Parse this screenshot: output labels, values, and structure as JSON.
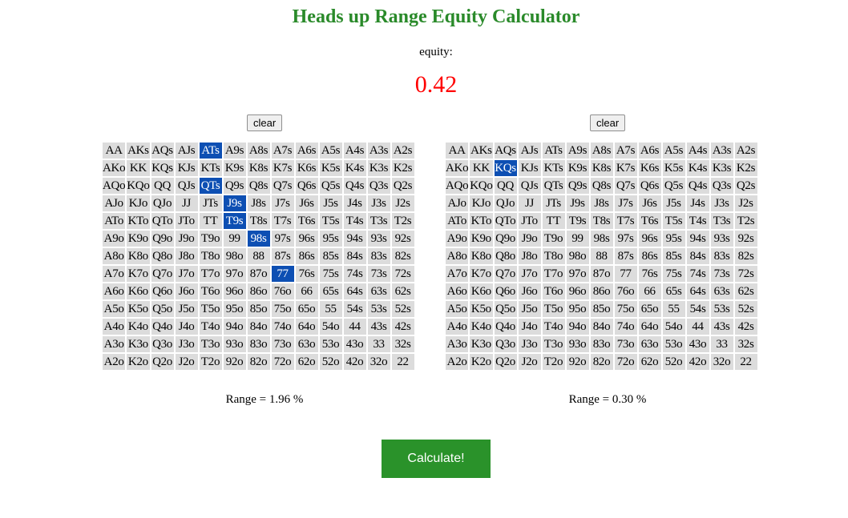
{
  "title": "Heads up Range Equity Calculator",
  "equity": {
    "label": "equity:",
    "value": "0.42"
  },
  "clear_label": "clear",
  "calculate_label": "Calculate!",
  "hands": [
    [
      "AA",
      "AKs",
      "AQs",
      "AJs",
      "ATs",
      "A9s",
      "A8s",
      "A7s",
      "A6s",
      "A5s",
      "A4s",
      "A3s",
      "A2s"
    ],
    [
      "AKo",
      "KK",
      "KQs",
      "KJs",
      "KTs",
      "K9s",
      "K8s",
      "K7s",
      "K6s",
      "K5s",
      "K4s",
      "K3s",
      "K2s"
    ],
    [
      "AQo",
      "KQo",
      "QQ",
      "QJs",
      "QTs",
      "Q9s",
      "Q8s",
      "Q7s",
      "Q6s",
      "Q5s",
      "Q4s",
      "Q3s",
      "Q2s"
    ],
    [
      "AJo",
      "KJo",
      "QJo",
      "JJ",
      "JTs",
      "J9s",
      "J8s",
      "J7s",
      "J6s",
      "J5s",
      "J4s",
      "J3s",
      "J2s"
    ],
    [
      "ATo",
      "KTo",
      "QTo",
      "JTo",
      "TT",
      "T9s",
      "T8s",
      "T7s",
      "T6s",
      "T5s",
      "T4s",
      "T3s",
      "T2s"
    ],
    [
      "A9o",
      "K9o",
      "Q9o",
      "J9o",
      "T9o",
      "99",
      "98s",
      "97s",
      "96s",
      "95s",
      "94s",
      "93s",
      "92s"
    ],
    [
      "A8o",
      "K8o",
      "Q8o",
      "J8o",
      "T8o",
      "98o",
      "88",
      "87s",
      "86s",
      "85s",
      "84s",
      "83s",
      "82s"
    ],
    [
      "A7o",
      "K7o",
      "Q7o",
      "J7o",
      "T7o",
      "97o",
      "87o",
      "77",
      "76s",
      "75s",
      "74s",
      "73s",
      "72s"
    ],
    [
      "A6o",
      "K6o",
      "Q6o",
      "J6o",
      "T6o",
      "96o",
      "86o",
      "76o",
      "66",
      "65s",
      "64s",
      "63s",
      "62s"
    ],
    [
      "A5o",
      "K5o",
      "Q5o",
      "J5o",
      "T5o",
      "95o",
      "85o",
      "75o",
      "65o",
      "55",
      "54s",
      "53s",
      "52s"
    ],
    [
      "A4o",
      "K4o",
      "Q4o",
      "J4o",
      "T4o",
      "94o",
      "84o",
      "74o",
      "64o",
      "54o",
      "44",
      "43s",
      "42s"
    ],
    [
      "A3o",
      "K3o",
      "Q3o",
      "J3o",
      "T3o",
      "93o",
      "83o",
      "73o",
      "63o",
      "53o",
      "43o",
      "33",
      "32s"
    ],
    [
      "A2o",
      "K2o",
      "Q2o",
      "J2o",
      "T2o",
      "92o",
      "82o",
      "72o",
      "62o",
      "52o",
      "42o",
      "32o",
      "22"
    ]
  ],
  "left": {
    "selected": [
      "ATs",
      "QTs",
      "J9s",
      "T9s",
      "98s",
      "77"
    ],
    "range_text": "Range = 1.96 %"
  },
  "right": {
    "selected": [
      "KQs"
    ],
    "range_text": "Range = 0.30 %"
  },
  "colors": {
    "title": "#2a8a2a",
    "equity": "#ff0000",
    "selected": "#0d4fb3",
    "cell": "#dcdcdc",
    "calculate": "#2a922a"
  }
}
